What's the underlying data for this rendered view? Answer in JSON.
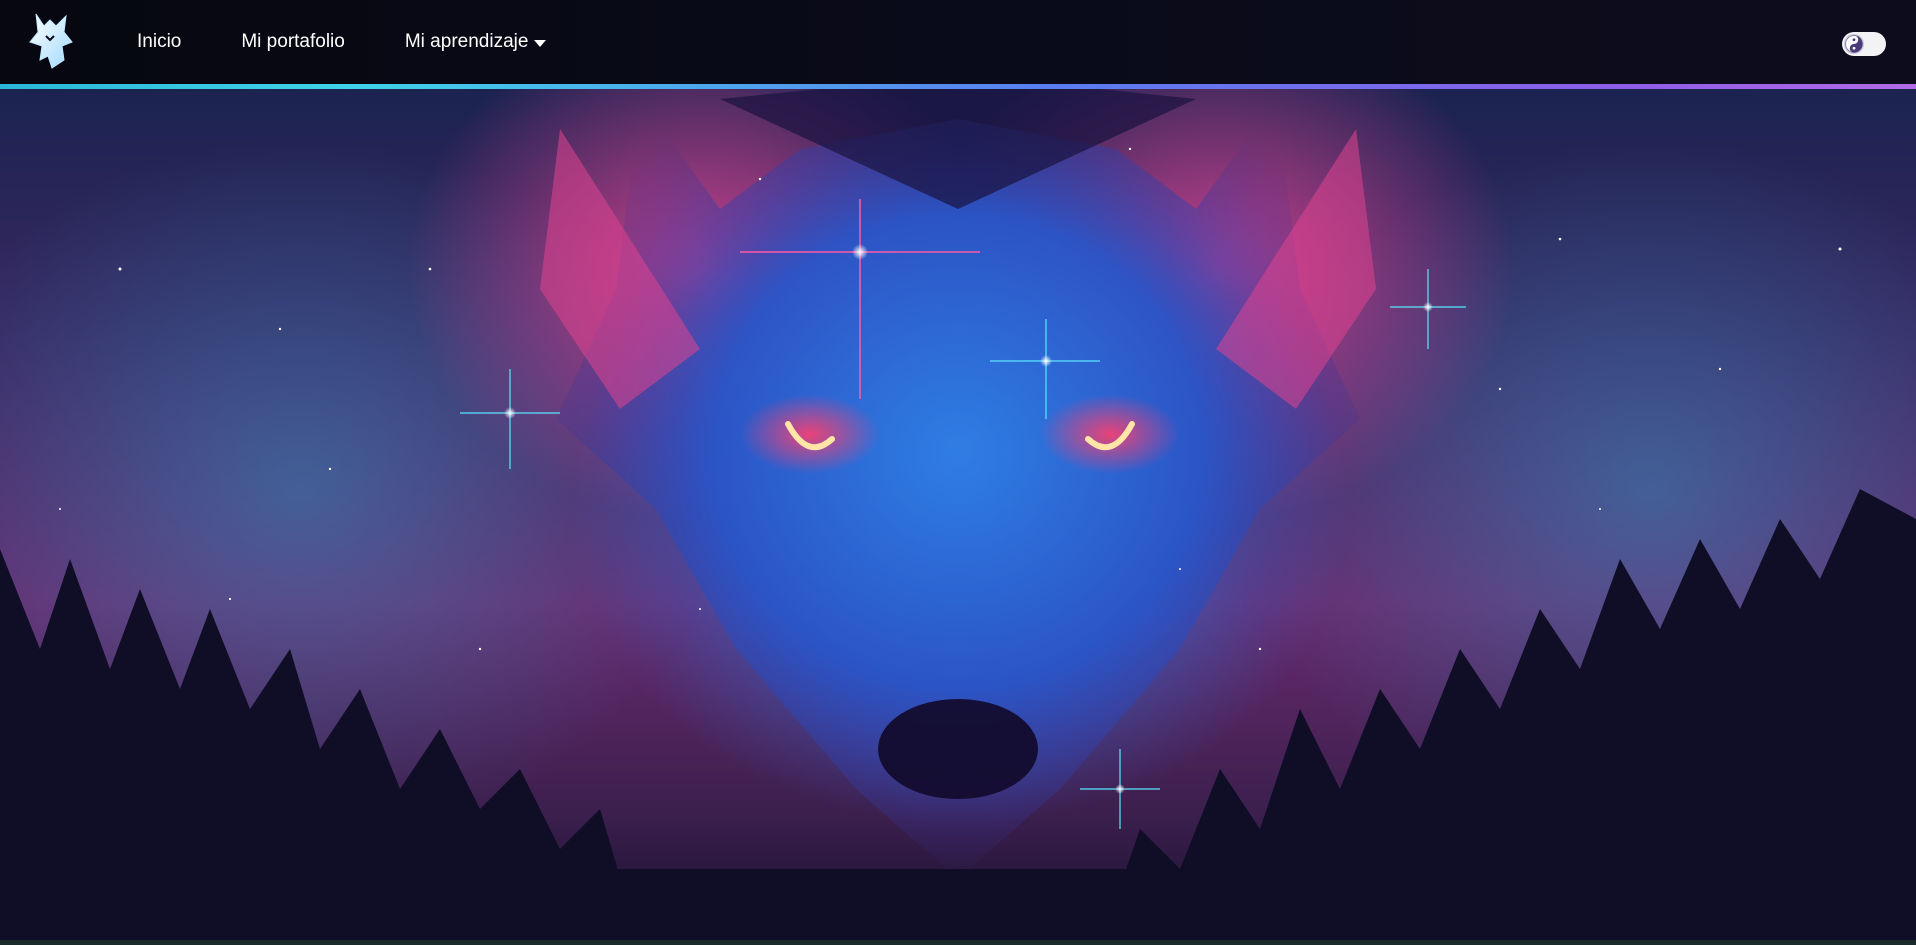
{
  "navbar": {
    "logo_icon": "wolf-head-logo-icon",
    "items": [
      {
        "label": "Inicio"
      },
      {
        "label": "Mi portafolio"
      },
      {
        "label": "Mi aprendizaje",
        "has_dropdown": true
      }
    ],
    "theme_toggle_icon": "yin-yang-icon",
    "accent_gradient": [
      "#2ab7d8",
      "#5a7df0",
      "#b16be6"
    ]
  },
  "hero": {
    "image_icon": "cosmic-wolf-illustration",
    "colors": {
      "blue": "#2a6fd8",
      "pink": "#e44696",
      "teal": "#348cbe",
      "eyes": "#ffe6a8",
      "forest": "#0f0e22"
    }
  }
}
